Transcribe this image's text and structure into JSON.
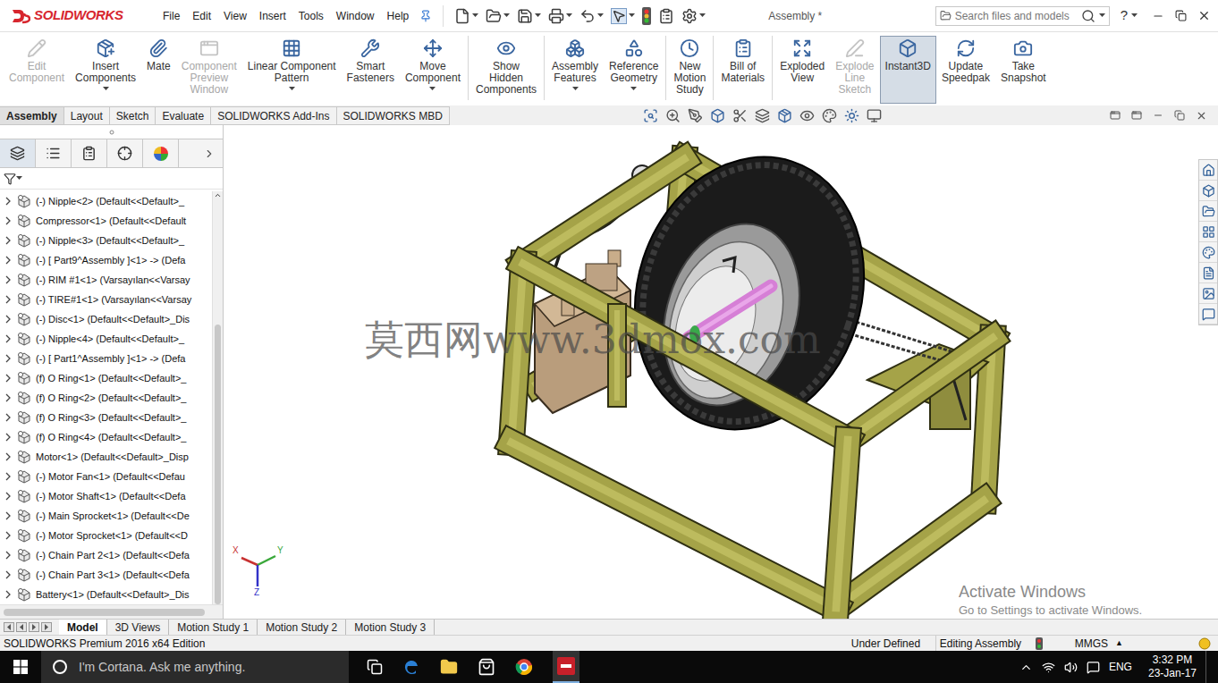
{
  "app": {
    "logo": "SOLIDWORKS",
    "title": "Assembly *"
  },
  "menu": [
    "File",
    "Edit",
    "View",
    "Insert",
    "Tools",
    "Window",
    "Help"
  ],
  "search": {
    "placeholder": "Search files and models"
  },
  "help": "?",
  "ribbon_groups": [
    {
      "commands": [
        {
          "lines": [
            "Edit",
            "Component"
          ],
          "disabled": true,
          "dropdown": false,
          "selected": false
        },
        {
          "lines": [
            "Insert",
            "Components"
          ],
          "disabled": false,
          "dropdown": true,
          "selected": false
        },
        {
          "lines": [
            "Mate"
          ],
          "disabled": false,
          "dropdown": false,
          "selected": false
        },
        {
          "lines": [
            "Component",
            "Preview",
            "Window"
          ],
          "disabled": true,
          "dropdown": false,
          "selected": false
        },
        {
          "lines": [
            "Linear Component",
            "Pattern"
          ],
          "disabled": false,
          "dropdown": true,
          "selected": false
        },
        {
          "lines": [
            "Smart",
            "Fasteners"
          ],
          "disabled": false,
          "dropdown": false,
          "selected": false
        },
        {
          "lines": [
            "Move",
            "Component"
          ],
          "disabled": false,
          "dropdown": true,
          "selected": false
        }
      ]
    },
    {
      "commands": [
        {
          "lines": [
            "Show",
            "Hidden",
            "Components"
          ],
          "disabled": false,
          "dropdown": false,
          "selected": false
        }
      ]
    },
    {
      "commands": [
        {
          "lines": [
            "Assembly",
            "Features"
          ],
          "disabled": false,
          "dropdown": true,
          "selected": false
        },
        {
          "lines": [
            "Reference",
            "Geometry"
          ],
          "disabled": false,
          "dropdown": true,
          "selected": false
        }
      ]
    },
    {
      "commands": [
        {
          "lines": [
            "New",
            "Motion",
            "Study"
          ],
          "disabled": false,
          "dropdown": false,
          "selected": false
        }
      ]
    },
    {
      "commands": [
        {
          "lines": [
            "Bill of",
            "Materials"
          ],
          "disabled": false,
          "dropdown": false,
          "selected": false
        }
      ]
    },
    {
      "commands": [
        {
          "lines": [
            "Exploded",
            "View"
          ],
          "disabled": false,
          "dropdown": false,
          "selected": false
        },
        {
          "lines": [
            "Explode",
            "Line",
            "Sketch"
          ],
          "disabled": true,
          "dropdown": false,
          "selected": false
        },
        {
          "lines": [
            "Instant3D"
          ],
          "disabled": false,
          "dropdown": false,
          "selected": true
        },
        {
          "lines": [
            "Update",
            "Speedpak"
          ],
          "disabled": false,
          "dropdown": false,
          "selected": false
        },
        {
          "lines": [
            "Take",
            "Snapshot"
          ],
          "disabled": false,
          "dropdown": false,
          "selected": false
        }
      ]
    }
  ],
  "command_tabs": [
    {
      "label": "Assembly",
      "selected": true
    },
    {
      "label": "Layout",
      "selected": false
    },
    {
      "label": "Sketch",
      "selected": false
    },
    {
      "label": "Evaluate",
      "selected": false
    },
    {
      "label": "SOLIDWORKS Add-Ins",
      "selected": false
    },
    {
      "label": "SOLIDWORKS MBD",
      "selected": false
    }
  ],
  "tree": {
    "items": [
      "(-) Nipple<2> (Default<<Default>_",
      "Compressor<1> (Default<<Default",
      "(-) Nipple<3> (Default<<Default>_",
      "(-) [ Part9^Assembly ]<1> -> (Defa",
      "(-) RIM #1<1> (Varsayılan<<Varsay",
      "(-) TIRE#1<1> (Varsayılan<<Varsay",
      "(-) Disc<1> (Default<<Default>_Dis",
      "(-) Nipple<4> (Default<<Default>_",
      "(-) [ Part1^Assembly ]<1> -> (Defa",
      "(f) O Ring<1> (Default<<Default>_",
      "(f) O Ring<2> (Default<<Default>_",
      "(f) O Ring<3> (Default<<Default>_",
      "(f) O Ring<4> (Default<<Default>_",
      "Motor<1> (Default<<Default>_Disp",
      "(-) Motor Fan<1> (Default<<Defau",
      "(-) Motor Shaft<1> (Default<<Defa",
      "(-) Main Sprocket<1> (Default<<De",
      "(-) Motor Sprocket<1> (Default<<D",
      "(-) Chain Part 2<1> (Default<<Defa",
      "(-) Chain Part 3<1> (Default<<Defa",
      "Battery<1> (Default<<Default>_Dis"
    ]
  },
  "canvas": {
    "watermark": "莫西网www.3dmox.com",
    "triad": [
      "X",
      "Y",
      "Z"
    ],
    "activation": {
      "title": "Activate Windows",
      "subtitle": "Go to Settings to activate Windows."
    }
  },
  "bottom_tabs": [
    {
      "label": "Model",
      "selected": true
    },
    {
      "label": "3D Views",
      "selected": false
    },
    {
      "label": "Motion Study 1",
      "selected": false
    },
    {
      "label": "Motion Study 2",
      "selected": false
    },
    {
      "label": "Motion Study 3",
      "selected": false
    }
  ],
  "status_bar": {
    "edition": "SOLIDWORKS Premium 2016 x64 Edition",
    "state": "Under Defined",
    "mode": "Editing Assembly",
    "units": "MMGS",
    "units_arrow": "▲"
  },
  "taskbar": {
    "search": "I'm Cortana. Ask me anything.",
    "language": "ENG",
    "time": "3:32 PM",
    "date": "23-Jan-17"
  }
}
